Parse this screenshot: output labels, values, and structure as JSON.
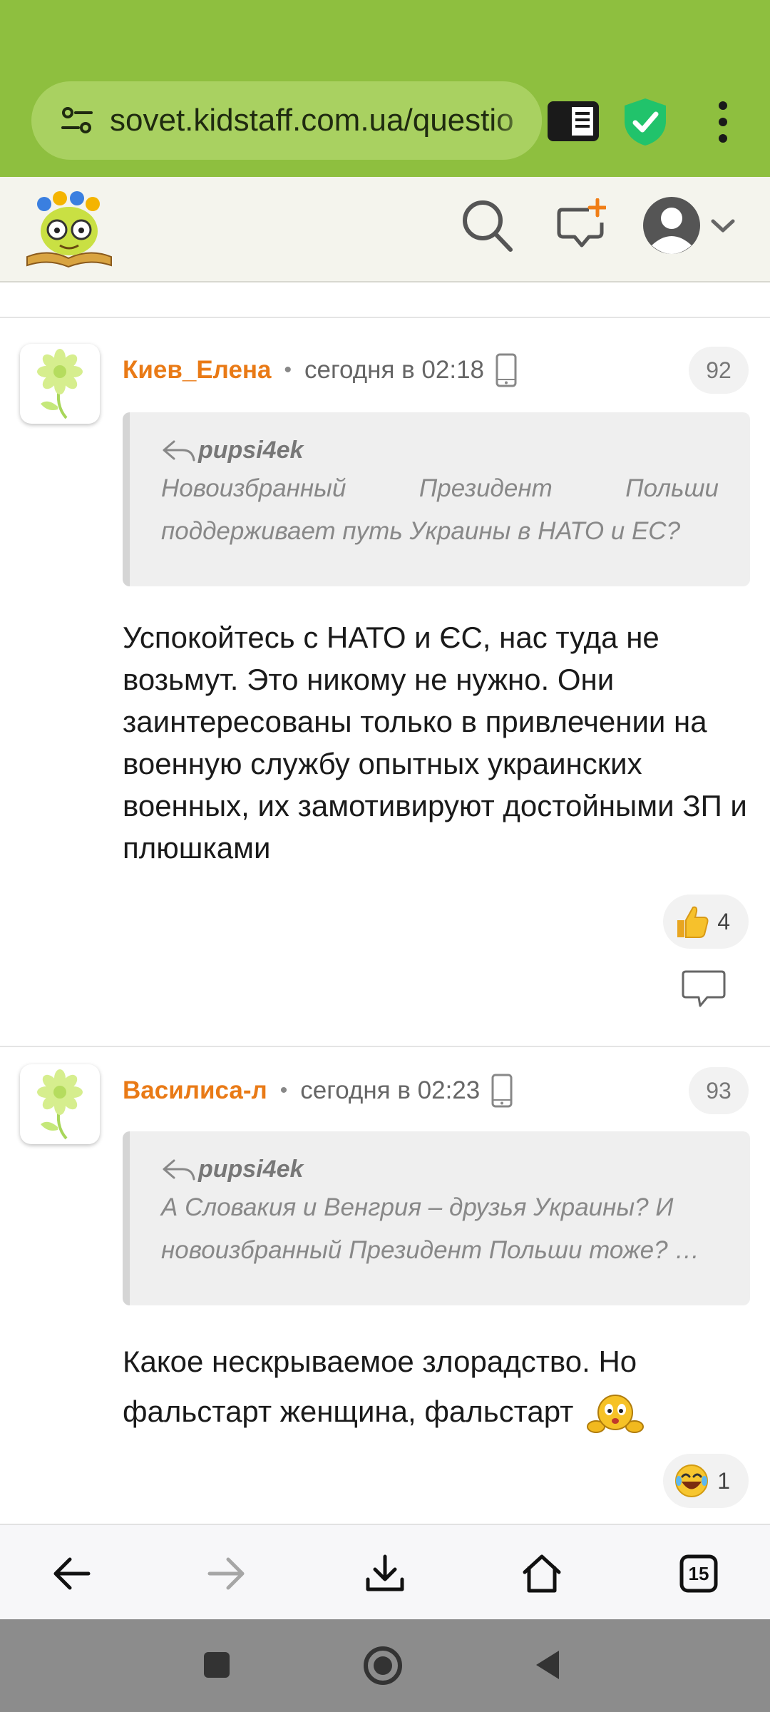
{
  "browser": {
    "url": "sovet.kidstaff.com.ua/questio",
    "icons": [
      "site-settings-icon",
      "reader-mode-icon",
      "shield-icon",
      "more-vert-icon"
    ],
    "accent": "#8ebf3f"
  },
  "site": {
    "header_icons": [
      "logo",
      "search-icon",
      "ask-question-icon",
      "user-avatar-icon",
      "chevron-down-icon"
    ]
  },
  "comments": [
    {
      "author": "Киев_Елена",
      "time": "сегодня в 02:18",
      "number": "92",
      "quote_author": "pupsi4ek",
      "quote_text": "Новоизбранный Президент Польши поддерживает путь Украины в НАТО и ЕС?",
      "text": "Успокойтесь с НАТО и ЄС, нас туда не возьмут. Это никому не нужно. Они заинтересованы только в привлечении на военную службу опытных украинских военных, их замотивируют достойными ЗП и плюшками",
      "reaction_icon": "thumbs-up-icon",
      "reaction_count": "4"
    },
    {
      "author": "Василиса-л",
      "time": "сегодня в 02:23",
      "number": "93",
      "quote_author": "pupsi4ek",
      "quote_text": "А Словакия и Венгрия – друзья Украины? И новоизбранный Президент Польши тоже? …",
      "text": "Какое нескрываемое злорадство. Но фальстарт женщина, фальстарт",
      "reaction_icon": "laughing-emoji-icon",
      "reaction_count": "1"
    }
  ],
  "bottom_nav": {
    "tabs_count": "15",
    "icons": [
      "back-arrow-icon",
      "forward-arrow-icon",
      "download-icon",
      "home-icon",
      "tabs-icon"
    ]
  },
  "system_nav": {
    "icons": [
      "recents-icon",
      "home-circle-icon",
      "back-triangle-icon"
    ]
  }
}
